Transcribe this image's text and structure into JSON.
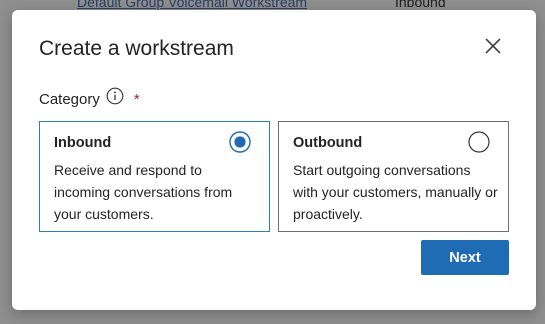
{
  "backdrop": {
    "row_link": "Default Group Voicemail Workstream",
    "row_direction": "Inbound"
  },
  "dialog": {
    "title": "Create a workstream",
    "close_icon": "close-icon",
    "category": {
      "label": "Category",
      "info_icon": "info-icon",
      "required_marker": "*",
      "required_color": "#a4262c"
    },
    "options": [
      {
        "title": "Inbound",
        "description": "Receive and respond to incoming conversations from your customers.",
        "selected": true
      },
      {
        "title": "Outbound",
        "description": "Start outgoing conversations with your customers, manually or proactively.",
        "selected": false
      }
    ],
    "next_label": "Next",
    "accent_color": "#1f6cb4"
  }
}
